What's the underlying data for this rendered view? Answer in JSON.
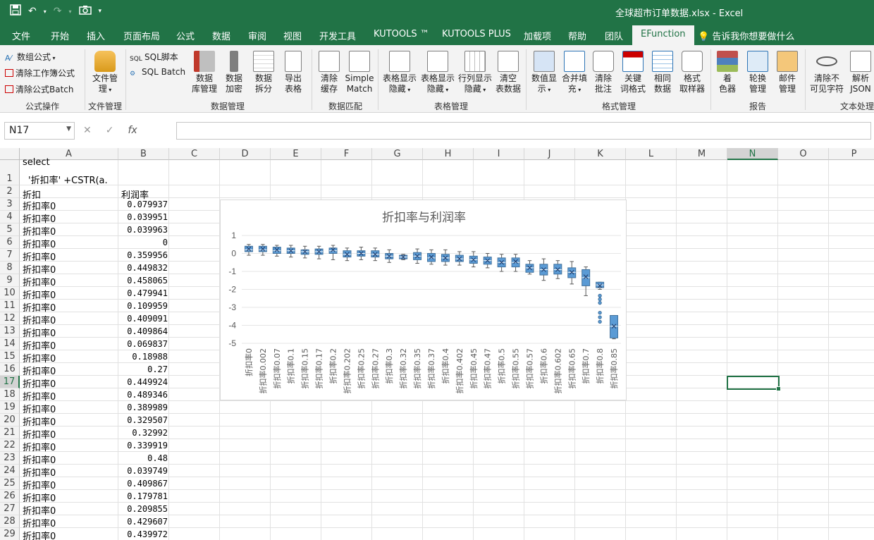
{
  "window": {
    "title": "全球超市订单数据.xlsx  -  Excel"
  },
  "qat": {
    "save_icon": "save-icon",
    "undo_icon": "undo-icon",
    "redo_icon": "redo-icon",
    "camera_icon": "camera-icon",
    "customize_icon": "customize-icon"
  },
  "tabs": [
    {
      "label": "文件"
    },
    {
      "label": "开始"
    },
    {
      "label": "插入"
    },
    {
      "label": "页面布局"
    },
    {
      "label": "公式"
    },
    {
      "label": "数据"
    },
    {
      "label": "审阅"
    },
    {
      "label": "视图"
    },
    {
      "label": "开发工具"
    },
    {
      "label": "KUTOOLS ™"
    },
    {
      "label": "KUTOOLS PLUS"
    },
    {
      "label": "加载项"
    },
    {
      "label": "帮助"
    },
    {
      "label": "团队"
    },
    {
      "label": "EFunction"
    }
  ],
  "tell_me": "告诉我你想要做什么",
  "ribbon": {
    "formula_ops": {
      "items": [
        "数组公式",
        "清除工作簿公式",
        "清除公式Batch"
      ],
      "label": "公式操作"
    },
    "file_mgmt": {
      "button": "文件管\n理",
      "label": "文件管理"
    },
    "sql": {
      "items": [
        "SQL脚本",
        "SQL Batch"
      ]
    },
    "data_mgmt": {
      "buttons": [
        "数据\n库管理",
        "数据\n加密",
        "数据\n拆分",
        "导出\n表格"
      ],
      "label": "数据管理"
    },
    "data_match": {
      "buttons": [
        "清除\n缓存",
        "Simple\nMatch"
      ],
      "label": "数据匹配"
    },
    "table_mgmt": {
      "buttons": [
        "表格显示\n隐藏",
        "表格显示\n隐藏",
        "行列显示\n隐藏",
        "清空\n表数据"
      ],
      "label": "表格管理"
    },
    "format_mgmt": {
      "buttons": [
        "数值显\n示",
        "合并填\n充",
        "清除\n批注",
        "关键\n词格式",
        "相同\n数据",
        "格式\n取样器"
      ],
      "label": "格式管理"
    },
    "report": {
      "buttons": [
        "着\n色器",
        "轮换\n管理",
        "邮件\n管理"
      ],
      "label": "报告"
    },
    "text_proc": {
      "buttons": [
        "清除不\n可见字符",
        "解析\nJSON"
      ],
      "label": "文本处理"
    }
  },
  "formula_bar": {
    "name_box": "N17",
    "formula": ""
  },
  "sheet": {
    "columns": [
      "A",
      "B",
      "C",
      "D",
      "E",
      "F",
      "G",
      "H",
      "I",
      "J",
      "K",
      "L",
      "M",
      "N",
      "O",
      "P"
    ],
    "selected_column": "N",
    "selected_row": "17",
    "row1": {
      "num": "1",
      "a_line1": "select",
      "a_line2": "'折扣率' +CSTR(a."
    },
    "row2": {
      "num": "2",
      "a": "折扣",
      "b": "利润率"
    },
    "rows": [
      {
        "num": "3",
        "a": "折扣率0",
        "b": "0.079937"
      },
      {
        "num": "4",
        "a": "折扣率0",
        "b": "0.039951"
      },
      {
        "num": "5",
        "a": "折扣率0",
        "b": "0.039963"
      },
      {
        "num": "6",
        "a": "折扣率0",
        "b": "0"
      },
      {
        "num": "7",
        "a": "折扣率0",
        "b": "0.359956"
      },
      {
        "num": "8",
        "a": "折扣率0",
        "b": "0.449832"
      },
      {
        "num": "9",
        "a": "折扣率0",
        "b": "0.458065"
      },
      {
        "num": "10",
        "a": "折扣率0",
        "b": "0.479941"
      },
      {
        "num": "11",
        "a": "折扣率0",
        "b": "0.109959"
      },
      {
        "num": "12",
        "a": "折扣率0",
        "b": "0.409091"
      },
      {
        "num": "13",
        "a": "折扣率0",
        "b": "0.409864"
      },
      {
        "num": "14",
        "a": "折扣率0",
        "b": "0.069837"
      },
      {
        "num": "15",
        "a": "折扣率0",
        "b": "0.18988"
      },
      {
        "num": "16",
        "a": "折扣率0",
        "b": "0.27"
      },
      {
        "num": "17",
        "a": "折扣率0",
        "b": "0.449924"
      },
      {
        "num": "18",
        "a": "折扣率0",
        "b": "0.489346"
      },
      {
        "num": "19",
        "a": "折扣率0",
        "b": "0.389989"
      },
      {
        "num": "20",
        "a": "折扣率0",
        "b": "0.329507"
      },
      {
        "num": "21",
        "a": "折扣率0",
        "b": "0.32992"
      },
      {
        "num": "22",
        "a": "折扣率0",
        "b": "0.339919"
      },
      {
        "num": "23",
        "a": "折扣率0",
        "b": "0.48"
      },
      {
        "num": "24",
        "a": "折扣率0",
        "b": "0.039749"
      },
      {
        "num": "25",
        "a": "折扣率0",
        "b": "0.409867"
      },
      {
        "num": "26",
        "a": "折扣率0",
        "b": "0.179781"
      },
      {
        "num": "27",
        "a": "折扣率0",
        "b": "0.209855"
      },
      {
        "num": "28",
        "a": "折扣率0",
        "b": "0.429607"
      },
      {
        "num": "29",
        "a": "折扣率0",
        "b": "0.439972"
      }
    ]
  },
  "chart_data": {
    "type": "box",
    "title": "折扣率与利润率",
    "xlabel": "",
    "ylabel": "",
    "ylim": [
      -5,
      1
    ],
    "yticks": [
      1,
      0,
      -1,
      -2,
      -3,
      -4,
      -5
    ],
    "color": "#5b9bd5",
    "categories": [
      "折扣率0",
      "折扣率0.002",
      "折扣率0.07",
      "折扣率0.1",
      "折扣率0.15",
      "折扣率0.17",
      "折扣率0.2",
      "折扣率0.202",
      "折扣率0.25",
      "折扣率0.27",
      "折扣率0.3",
      "折扣率0.32",
      "折扣率0.35",
      "折扣率0.37",
      "折扣率0.4",
      "折扣率0.402",
      "折扣率0.45",
      "折扣率0.47",
      "折扣率0.5",
      "折扣率0.55",
      "折扣率0.57",
      "折扣率0.6",
      "折扣率0.602",
      "折扣率0.65",
      "折扣率0.7",
      "折扣率0.8",
      "折扣率0.85"
    ],
    "boxes": [
      {
        "min": -0.1,
        "q1": 0.1,
        "median": 0.2,
        "q3": 0.4,
        "max": 0.5,
        "mean": 0.25
      },
      {
        "min": -0.1,
        "q1": 0.1,
        "median": 0.2,
        "q3": 0.4,
        "max": 0.5,
        "mean": 0.25
      },
      {
        "min": -0.15,
        "q1": 0.0,
        "median": 0.15,
        "q3": 0.35,
        "max": 0.45,
        "mean": 0.2
      },
      {
        "min": -0.2,
        "q1": 0.0,
        "median": 0.15,
        "q3": 0.3,
        "max": 0.45,
        "mean": 0.15
      },
      {
        "min": -0.25,
        "q1": -0.05,
        "median": 0.1,
        "q3": 0.2,
        "max": 0.4,
        "mean": 0.1
      },
      {
        "min": -0.3,
        "q1": -0.05,
        "median": 0.1,
        "q3": 0.25,
        "max": 0.4,
        "mean": 0.1
      },
      {
        "min": -0.35,
        "q1": 0.0,
        "median": 0.15,
        "q3": 0.3,
        "max": 0.45,
        "mean": 0.2
      },
      {
        "min": -0.4,
        "q1": -0.2,
        "median": -0.05,
        "q3": 0.15,
        "max": 0.3,
        "mean": -0.05
      },
      {
        "min": -0.35,
        "q1": -0.15,
        "median": 0.0,
        "q3": 0.15,
        "max": 0.35,
        "mean": 0.0
      },
      {
        "min": -0.4,
        "q1": -0.2,
        "median": -0.05,
        "q3": 0.15,
        "max": 0.3,
        "mean": -0.05
      },
      {
        "min": -0.5,
        "q1": -0.3,
        "median": -0.15,
        "q3": 0.0,
        "max": 0.2,
        "mean": -0.15
      },
      {
        "min": -0.35,
        "q1": -0.3,
        "median": -0.2,
        "q3": -0.1,
        "max": -0.05,
        "mean": -0.2
      },
      {
        "min": -0.55,
        "q1": -0.35,
        "median": -0.15,
        "q3": 0.05,
        "max": 0.25,
        "mean": -0.15
      },
      {
        "min": -0.6,
        "q1": -0.45,
        "median": -0.25,
        "q3": 0.0,
        "max": 0.2,
        "mean": -0.2
      },
      {
        "min": -0.65,
        "q1": -0.45,
        "median": -0.25,
        "q3": -0.05,
        "max": 0.2,
        "mean": -0.25
      },
      {
        "min": -0.65,
        "q1": -0.45,
        "median": -0.3,
        "q3": -0.1,
        "max": 0.1,
        "mean": -0.3
      },
      {
        "min": -0.75,
        "q1": -0.55,
        "median": -0.35,
        "q3": -0.15,
        "max": 0.1,
        "mean": -0.35
      },
      {
        "min": -0.8,
        "q1": -0.6,
        "median": -0.4,
        "q3": -0.2,
        "max": 0.0,
        "mean": -0.4
      },
      {
        "min": -1.0,
        "q1": -0.75,
        "median": -0.5,
        "q3": -0.25,
        "max": -0.05,
        "mean": -0.5
      },
      {
        "min": -1.0,
        "q1": -0.75,
        "median": -0.5,
        "q3": -0.25,
        "max": -0.05,
        "mean": -0.45
      },
      {
        "min": -1.15,
        "q1": -1.05,
        "median": -0.8,
        "q3": -0.6,
        "max": -0.4,
        "mean": -0.8
      },
      {
        "min": -1.5,
        "q1": -1.2,
        "median": -0.9,
        "q3": -0.6,
        "max": -0.3,
        "mean": -0.9
      },
      {
        "min": -1.4,
        "q1": -1.15,
        "median": -0.9,
        "q3": -0.6,
        "max": -0.4,
        "mean": -0.9
      },
      {
        "min": -1.7,
        "q1": -1.35,
        "median": -1.05,
        "q3": -0.8,
        "max": -0.45,
        "mean": -1.05
      },
      {
        "min": -2.35,
        "q1": -1.8,
        "median": -1.35,
        "q3": -0.9,
        "max": -0.75,
        "mean": -1.3
      },
      {
        "min": -2.0,
        "q1": -1.9,
        "median": -1.75,
        "q3": -1.6,
        "max": -1.6,
        "mean": -1.8,
        "outliers": [
          -2.35,
          -2.55,
          -2.75,
          -3.3,
          -3.55,
          -3.8
        ]
      },
      {
        "min": -4.75,
        "q1": -4.7,
        "median": -4.05,
        "q3": -3.45,
        "max": -3.45,
        "mean": -4.05
      }
    ]
  }
}
